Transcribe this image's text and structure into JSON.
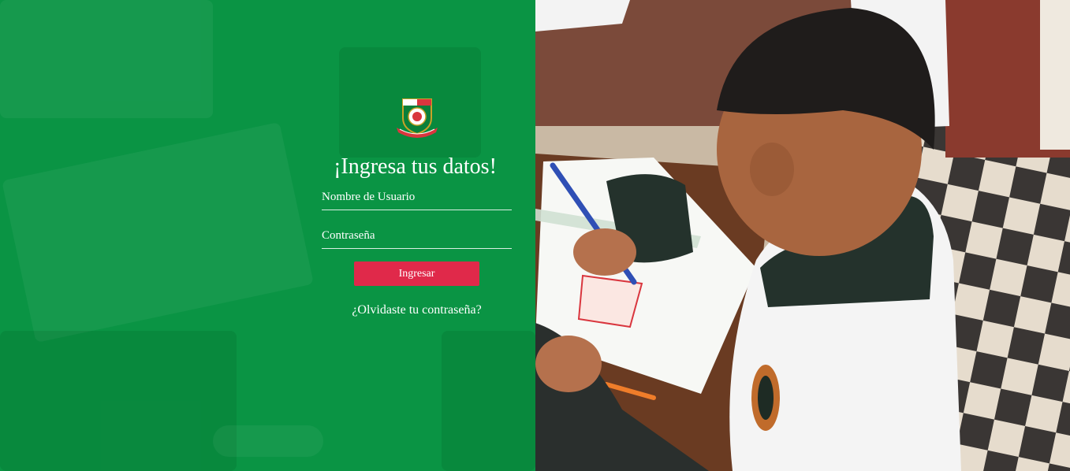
{
  "login": {
    "title": "¡Ingresa tus datos!",
    "username_label": "Nombre de Usuario",
    "password_label": "Contraseña",
    "submit_label": "Ingresar",
    "forgot_label": "¿Olvidaste tu contraseña?"
  },
  "colors": {
    "panel_green": "#0a9444",
    "button_red": "#e0294a",
    "text": "#ffffff"
  },
  "icons": {
    "logo": "school-crest-icon"
  }
}
